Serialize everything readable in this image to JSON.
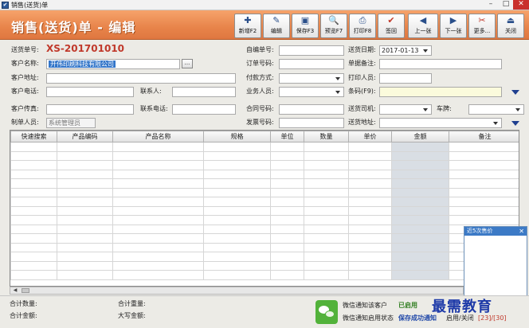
{
  "window": {
    "title": "销售(送货)单",
    "minimize": "–",
    "maximize": "□",
    "close": "✕"
  },
  "header": {
    "title": "销售(送货)单 - 编辑"
  },
  "toolbar": [
    {
      "label": "新增F2",
      "icon": "✚"
    },
    {
      "label": "编辑",
      "icon": "✎"
    },
    {
      "label": "保存F3",
      "icon": "▣"
    },
    {
      "label": "预览F7",
      "icon": "🔍"
    },
    {
      "label": "打印F8",
      "icon": "⎙"
    },
    {
      "label": "签回",
      "icon": "✔"
    },
    {
      "label": "上一张",
      "icon": "◀"
    },
    {
      "label": "下一张",
      "icon": "▶"
    },
    {
      "label": "更多...",
      "icon": "✂"
    },
    {
      "label": "关闭",
      "icon": "⏏"
    }
  ],
  "form": {
    "doc_no_label": "送货单号:",
    "doc_no": "XS-201701010",
    "customer_label": "客户名称:",
    "customer_value": "开伟印刷科技有限公司",
    "customer_btn": "...",
    "address_label": "客户地址:",
    "phone_label": "客户电话:",
    "contact_label": "联系人:",
    "fax_label": "客户传真:",
    "contact_phone_label": "联系电话:",
    "creator_label": "制单人员:",
    "creator_value": "系统管理员",
    "own_no_label": "自编单号:",
    "order_no_label": "订单号码:",
    "payment_label": "付款方式:",
    "salesman_label": "业务人员:",
    "contract_label": "合同号码:",
    "invoice_label": "发票号码:",
    "date_label": "送货日期:",
    "date_value": "2017-01-13",
    "remark_label": "单据备注:",
    "printer_label": "打印人员:",
    "barcode_label": "条码(F9):",
    "driver_label": "送货司机:",
    "plate_label": "车牌:",
    "delivery_addr_label": "送货地址:"
  },
  "grid": {
    "columns": [
      "快速搜索",
      "产品编码",
      "产品名称",
      "规格",
      "单位",
      "数量",
      "单价",
      "金额",
      "备注"
    ]
  },
  "popup": {
    "title": "近5次售价",
    "close": "✕"
  },
  "footer": {
    "total_qty_label": "合计数量:",
    "total_amount_label": "合计金额:",
    "total_weight_label": "合计重量:",
    "amount_upper_label": "大写金额:",
    "wechat_notify_label": "微信通知该客户",
    "wechat_status": "已启用",
    "wechat_enable_label": "微信通知启用状态",
    "save_notify": "保存成功通知",
    "enable_close": "启用/关闭",
    "counter": "[23]/[30]"
  },
  "watermark": "最需教育",
  "colors": {
    "toolbar": "#e8844a",
    "title": "#ffffff",
    "doc_no": "#c0392b",
    "selection": "#3476c9"
  }
}
